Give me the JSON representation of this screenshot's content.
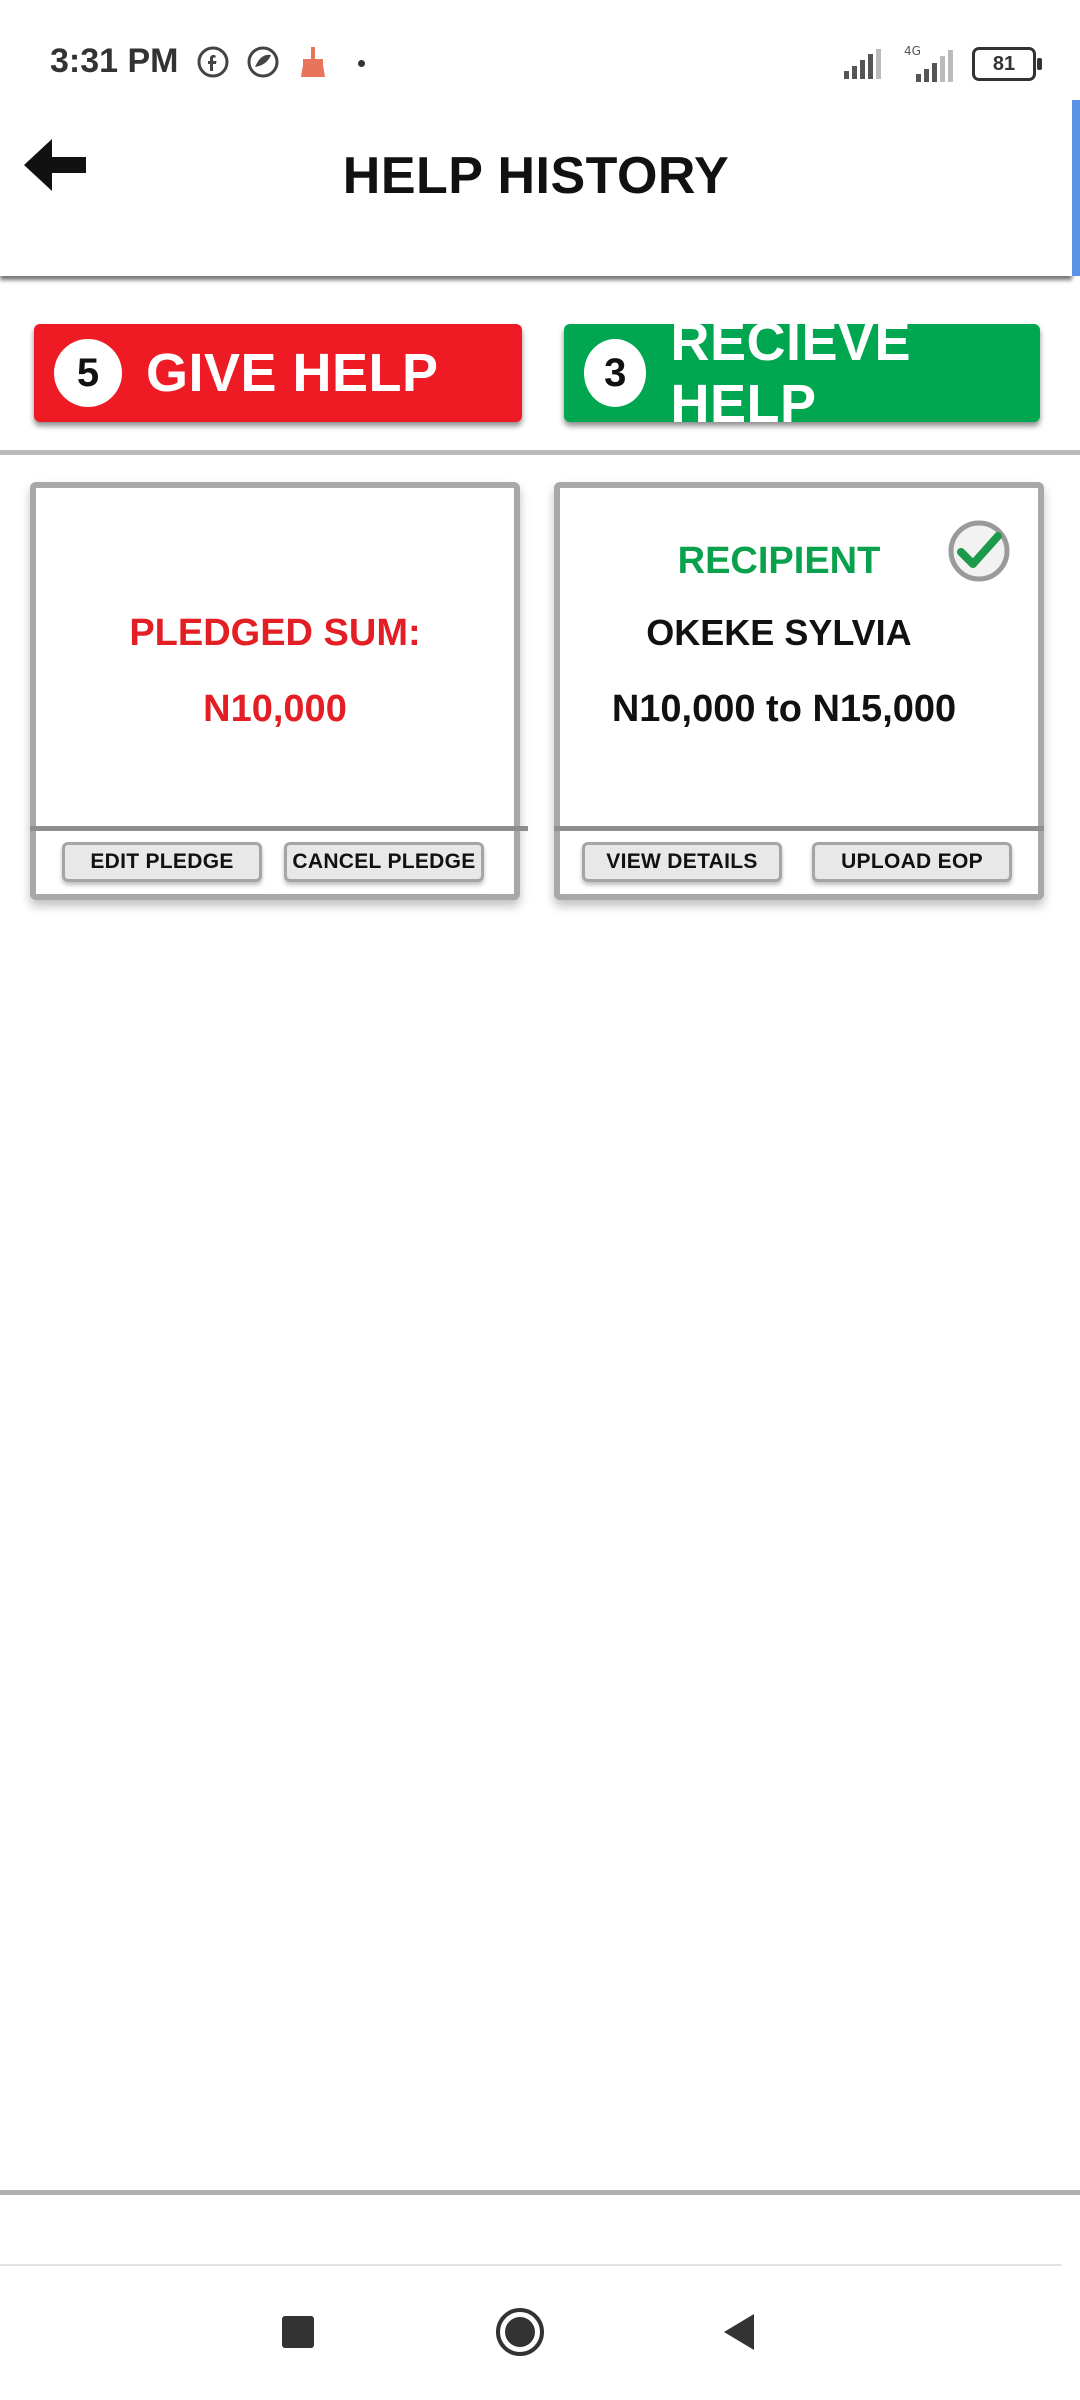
{
  "status_bar": {
    "time": "3:31 PM",
    "battery": "81",
    "network": "4G",
    "icons_left": [
      "facebook-icon",
      "browser-icon",
      "cleaner-icon"
    ],
    "icons_right": [
      "signal-icon",
      "signal-4g-icon",
      "battery-icon"
    ]
  },
  "header": {
    "title": "HELP HISTORY",
    "back_icon": "back-arrow-icon"
  },
  "tabs": {
    "give": {
      "count": "5",
      "label": "GIVE HELP",
      "color": "#ee1b24"
    },
    "receive": {
      "count": "3",
      "label": "RECIEVE HELP",
      "color": "#00a650"
    }
  },
  "cards": {
    "pledge": {
      "label": "PLEDGED SUM:",
      "amount": "N10,000",
      "buttons": {
        "edit": "EDIT PLEDGE",
        "cancel": "CANCEL PLEDGE"
      }
    },
    "recipient": {
      "label": "RECIPIENT",
      "name": "OKEKE SYLVIA",
      "range": "N10,000 to N15,000",
      "status_icon": "check-circle-icon",
      "buttons": {
        "view": "VIEW DETAILS",
        "upload": "UPLOAD EOP"
      }
    }
  },
  "colors": {
    "give_red": "#ee1b24",
    "receive_green": "#00a650",
    "pledge_text_red": "#e31e24",
    "recipient_text_green": "#0aa14d"
  },
  "nav_bar": {
    "icons": [
      "recents-square-icon",
      "home-circle-icon",
      "back-triangle-icon"
    ]
  }
}
